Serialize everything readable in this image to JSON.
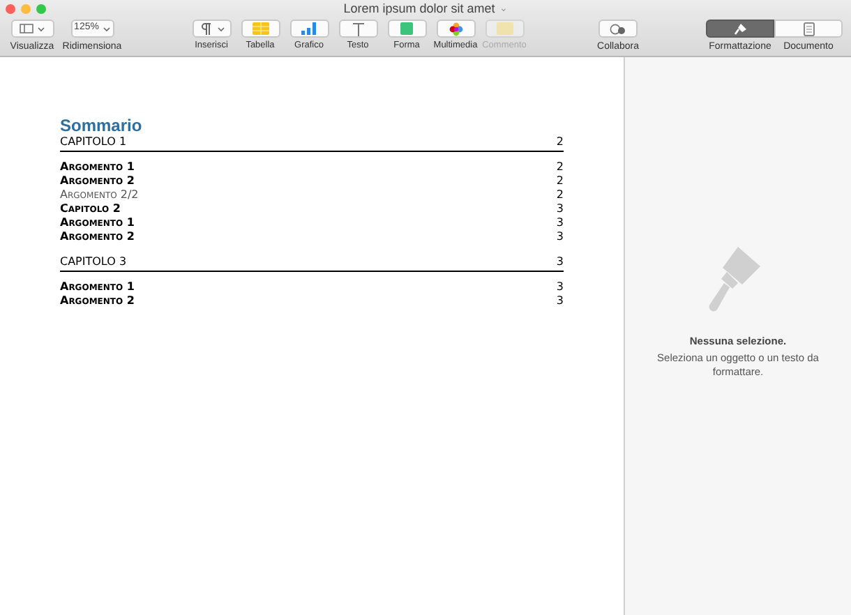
{
  "window": {
    "title": "Lorem ipsum dolor sit amet",
    "title_menu": "⌄"
  },
  "toolbar": {
    "left": [
      {
        "kind": "view",
        "label": "Visualizza"
      },
      {
        "kind": "zoom",
        "label": "Ridimensiona",
        "value": "125%"
      }
    ],
    "center": [
      {
        "kind": "insert",
        "label": "Inserisci",
        "disabled": false
      },
      {
        "kind": "table",
        "label": "Tabella",
        "disabled": false
      },
      {
        "kind": "chart",
        "label": "Grafico",
        "disabled": false
      },
      {
        "kind": "text",
        "label": "Testo",
        "disabled": false
      },
      {
        "kind": "shape",
        "label": "Forma",
        "disabled": false
      },
      {
        "kind": "media",
        "label": "Multimedia",
        "disabled": false
      },
      {
        "kind": "comment",
        "label": "Commento",
        "disabled": true
      }
    ],
    "collaborate": {
      "label": "Collabora"
    },
    "inspector_tabs": [
      {
        "kind": "format",
        "label": "Formattazione",
        "selected": true
      },
      {
        "kind": "document",
        "label": "Documento",
        "selected": false
      }
    ]
  },
  "document": {
    "heading": "Sommario",
    "toc": [
      {
        "kind": "chapter",
        "title": "CAPITOLO 1",
        "page": "2"
      },
      {
        "kind": "entry",
        "title": "Argomento 1",
        "page": "2"
      },
      {
        "kind": "entry",
        "title": "Argomento 2",
        "page": "2"
      },
      {
        "kind": "light",
        "title": "Argomento 2/2",
        "page": "2"
      },
      {
        "kind": "entry",
        "title": "Capitolo 2",
        "page": "3"
      },
      {
        "kind": "entry",
        "title": "Argomento 1",
        "page": "3"
      },
      {
        "kind": "entry",
        "title": "Argomento 2",
        "page": "3"
      },
      {
        "kind": "chapter",
        "title": "CAPITOLO 3",
        "page": "3"
      },
      {
        "kind": "entry",
        "title": "Argomento 1",
        "page": "3"
      },
      {
        "kind": "entry",
        "title": "Argomento 2",
        "page": "3"
      }
    ]
  },
  "inspector": {
    "title": "Nessuna selezione.",
    "message": "Seleziona un oggetto o un testo da formattare."
  }
}
